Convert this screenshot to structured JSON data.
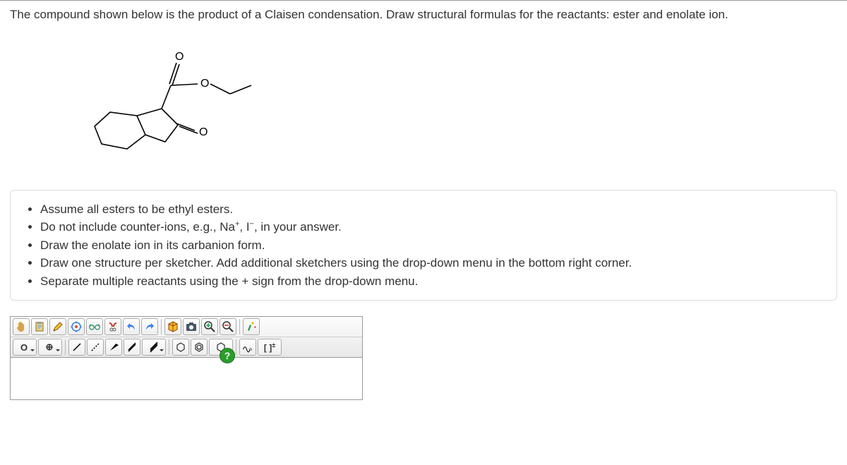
{
  "question": "The compound shown below is the product of a Claisen condensation. Draw structural formulas for the reactants: ester and enolate ion.",
  "instructions": {
    "item1": "Assume all esters to be ethyl esters.",
    "item2_pre": "Do not include counter-ions, e.g., Na",
    "item2_sup1": "+",
    "item2_mid": ", I",
    "item2_sup2": "−",
    "item2_post": ", in your answer.",
    "item3": "Draw the enolate ion in its carbanion form.",
    "item4": "Draw one structure per sketcher. Add additional sketchers using the drop-down menu in the bottom right corner.",
    "item5": "Separate multiple reactants using the + sign from the drop-down menu."
  },
  "toolbar": {
    "row1": {
      "hand": "hand-icon",
      "paste": "clipboard-icon",
      "pencil": "pencil-icon",
      "target": "target-icon",
      "glasses": "glasses-icon",
      "link_break": "link-break-icon",
      "undo": "undo-icon",
      "redo": "redo-icon",
      "view3d": "cube-icon",
      "snapshot": "camera-icon",
      "zoom_in": "zoom-in-icon",
      "zoom_out": "zoom-out-icon",
      "clean": "clean-icon"
    },
    "row2": {
      "atom_label": "O",
      "charge_label": "⊕",
      "single_bond": "single-bond-icon",
      "dashed_bond": "dashed-bond-icon",
      "wedge_bond": "wedge-bond-icon",
      "double_bond": "double-bond-icon",
      "triple_bond": "triple-bond-icon",
      "hexagon1": "hexagon-icon",
      "hexagon2": "hexagon-ring-icon",
      "hexagon3": "hexagon-open-icon",
      "curve_n": "curve-n-icon",
      "bracket": "[ ]",
      "bracket_charge": "±"
    }
  },
  "help": "?"
}
